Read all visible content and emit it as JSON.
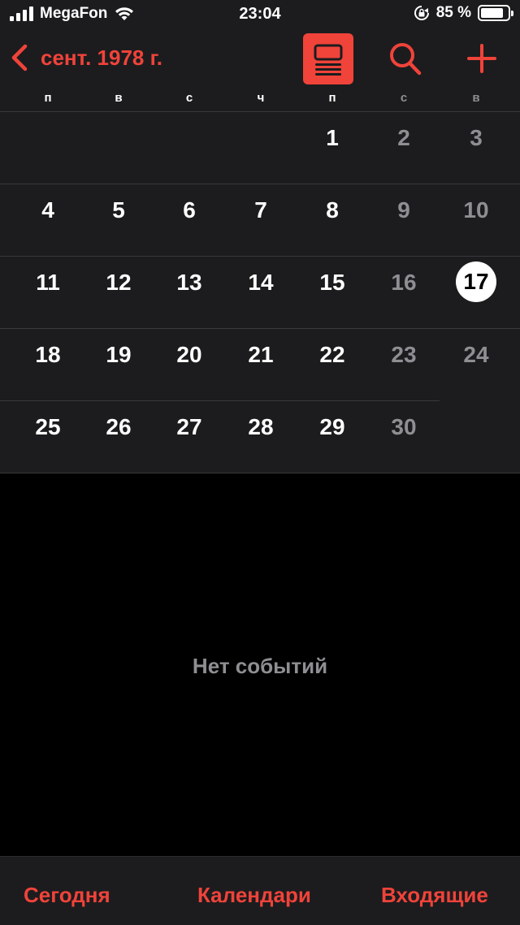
{
  "status_bar": {
    "carrier": "MegaFon",
    "time": "23:04",
    "battery_percent": "85 %",
    "battery_level": 0.85
  },
  "nav": {
    "back_label": "сент. 1978 г.",
    "accent_color": "#f0433a"
  },
  "weekdays": [
    "п",
    "в",
    "с",
    "ч",
    "п",
    "с",
    "в"
  ],
  "weeks": [
    [
      "",
      "",
      "",
      "",
      "1",
      "2",
      "3"
    ],
    [
      "4",
      "5",
      "6",
      "7",
      "8",
      "9",
      "10"
    ],
    [
      "11",
      "12",
      "13",
      "14",
      "15",
      "16",
      "17"
    ],
    [
      "18",
      "19",
      "20",
      "21",
      "22",
      "23",
      "24"
    ],
    [
      "25",
      "26",
      "27",
      "28",
      "29",
      "30",
      ""
    ]
  ],
  "today": "17",
  "events": {
    "empty_text": "Нет событий"
  },
  "tab_bar": {
    "today": "Сегодня",
    "calendars": "Календари",
    "inbox": "Входящие"
  }
}
